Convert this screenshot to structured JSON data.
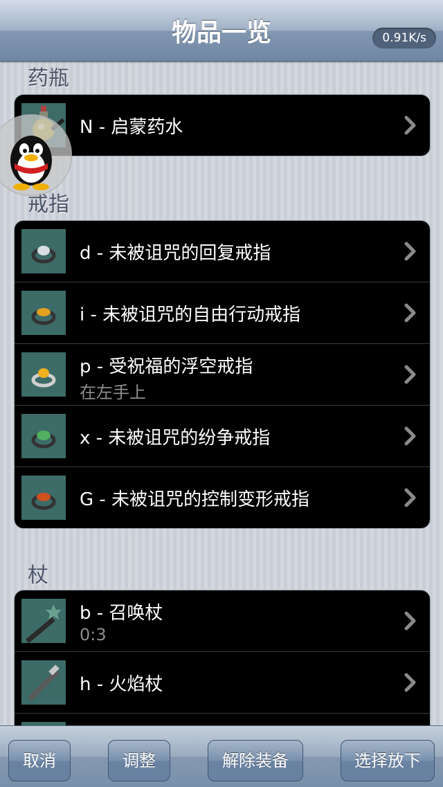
{
  "navbar": {
    "title": "物品一览",
    "speed": "0.91K/s"
  },
  "sections": {
    "potions": {
      "header": "药瓶",
      "items": [
        {
          "label": "N - 启蒙药水"
        }
      ]
    },
    "rings": {
      "header": "戒指",
      "items": [
        {
          "label": "d - 未被诅咒的回复戒指"
        },
        {
          "label": "i - 未被诅咒的自由行动戒指"
        },
        {
          "label": "p - 受祝福的浮空戒指",
          "sub": "在左手上"
        },
        {
          "label": "x - 未被诅咒的纷争戒指"
        },
        {
          "label": "G - 未被诅咒的控制变形戒指"
        }
      ]
    },
    "wands": {
      "header": "杖",
      "items": [
        {
          "label": "b - 召唤杖",
          "sub": "0:3"
        },
        {
          "label": "h - 火焰杖"
        }
      ]
    }
  },
  "toolbar": {
    "cancel": "取消",
    "adjust": "调整",
    "unequip": "解除装备",
    "drop": "选择放下"
  },
  "icons": {
    "chevron": "chevron-right-icon",
    "floating_widget": "qq-penguin-icon",
    "potion": "potion-icon",
    "ring": "ring-icon",
    "wand": "wand-icon"
  },
  "colors": {
    "ring_gems": [
      "#d8dee2",
      "#e0a020",
      "#f0b020",
      "#50b060",
      "#d05020"
    ]
  }
}
